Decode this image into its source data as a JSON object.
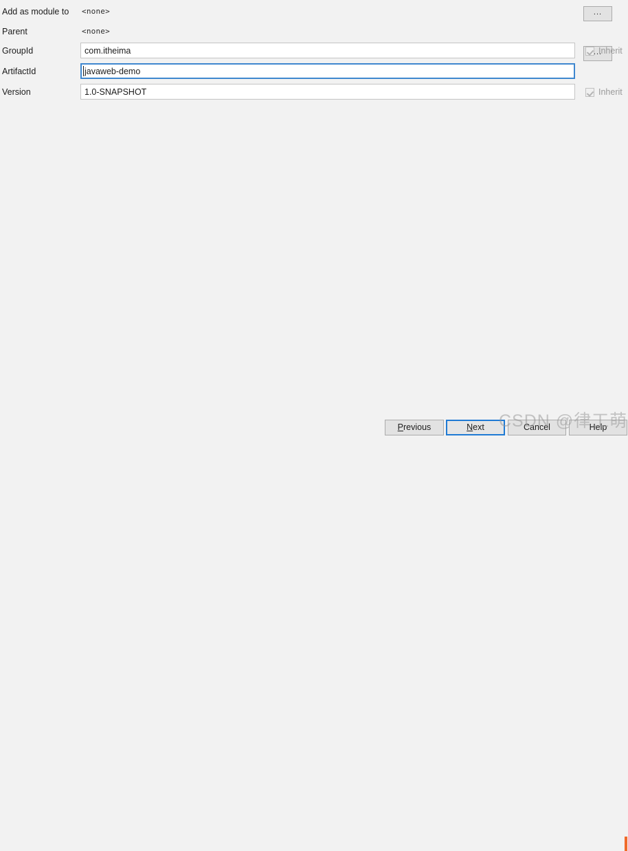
{
  "dialog": {
    "background_color": "#f2f2f2",
    "accent_color": "#1f7ad4"
  },
  "form": {
    "rows": [
      {
        "label": "Add as module to",
        "type": "static",
        "value": "<none>",
        "has_browse_button": true,
        "browse_label": "...",
        "has_inherit": false
      },
      {
        "label": "Parent",
        "type": "static",
        "value": "<none>",
        "has_browse_button": true,
        "browse_label": "...",
        "has_inherit": false
      },
      {
        "label": "GroupId",
        "type": "textfield",
        "value": "com.itheima",
        "placeholder": "",
        "focused": false,
        "has_browse_button": false,
        "has_inherit": true,
        "inherit_label": "Inherit",
        "inherit_checked": true,
        "inherit_enabled": false
      },
      {
        "label": "ArtifactId",
        "type": "textfield",
        "value": "javaweb-demo",
        "placeholder": "",
        "focused": true,
        "has_browse_button": false,
        "has_inherit": false
      },
      {
        "label": "Version",
        "type": "textfield",
        "value": "1.0-SNAPSHOT",
        "placeholder": "",
        "focused": false,
        "has_browse_button": false,
        "has_inherit": true,
        "inherit_label": "Inherit",
        "inherit_checked": true,
        "inherit_enabled": false
      }
    ]
  },
  "buttons": {
    "previous": {
      "label": "Previous",
      "mnemonic": "P",
      "default": false
    },
    "next": {
      "label": "Next",
      "mnemonic": "N",
      "default": true
    },
    "cancel": {
      "label": "Cancel",
      "mnemonic": "",
      "default": false
    },
    "help": {
      "label": "Help",
      "mnemonic": "",
      "default": false
    }
  },
  "watermark": {
    "text": "CSDN @律工萌萌哒"
  }
}
